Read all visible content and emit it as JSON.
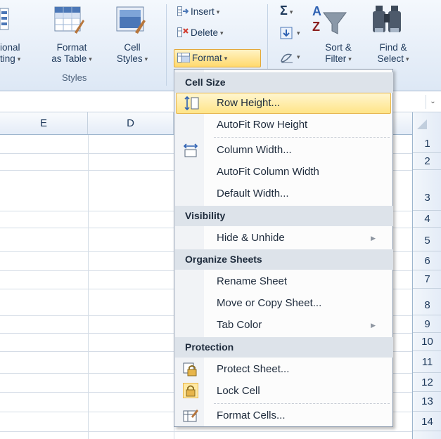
{
  "ribbon": {
    "conditional_label_line1": "ional",
    "conditional_label_line2": "ting",
    "format_table_line1": "Format",
    "format_table_line2": "as Table",
    "cell_styles_line1": "Cell",
    "cell_styles_line2": "Styles",
    "styles_group": "Styles",
    "insert_label": "Insert",
    "delete_label": "Delete",
    "format_label": "Format",
    "sort_filter_line1": "Sort &",
    "sort_filter_line2": "Filter",
    "find_select_line1": "Find &",
    "find_select_line2": "Select",
    "sigma": "Σ"
  },
  "columns": [
    "E",
    "D"
  ],
  "rows": [
    "1",
    "2",
    "3",
    "4",
    "5",
    "6",
    "7",
    "8",
    "9",
    "10",
    "11",
    "12",
    "13",
    "14"
  ],
  "menu": {
    "cell_size": "Cell Size",
    "row_height": "Row Height...",
    "autofit_row_height": "AutoFit Row Height",
    "column_width": "Column Width...",
    "autofit_column_width": "AutoFit Column Width",
    "default_width": "Default Width...",
    "visibility": "Visibility",
    "hide_unhide": "Hide & Unhide",
    "organize_sheets": "Organize Sheets",
    "rename_sheet": "Rename Sheet",
    "move_copy_sheet": "Move or Copy Sheet...",
    "tab_color": "Tab Color",
    "protection": "Protection",
    "protect_sheet": "Protect Sheet...",
    "lock_cell": "Lock Cell",
    "format_cells": "Format Cells..."
  },
  "colors": {
    "highlight": "#ffe488",
    "ribbon_bg": "#e6eef8",
    "text": "#1e395b"
  }
}
